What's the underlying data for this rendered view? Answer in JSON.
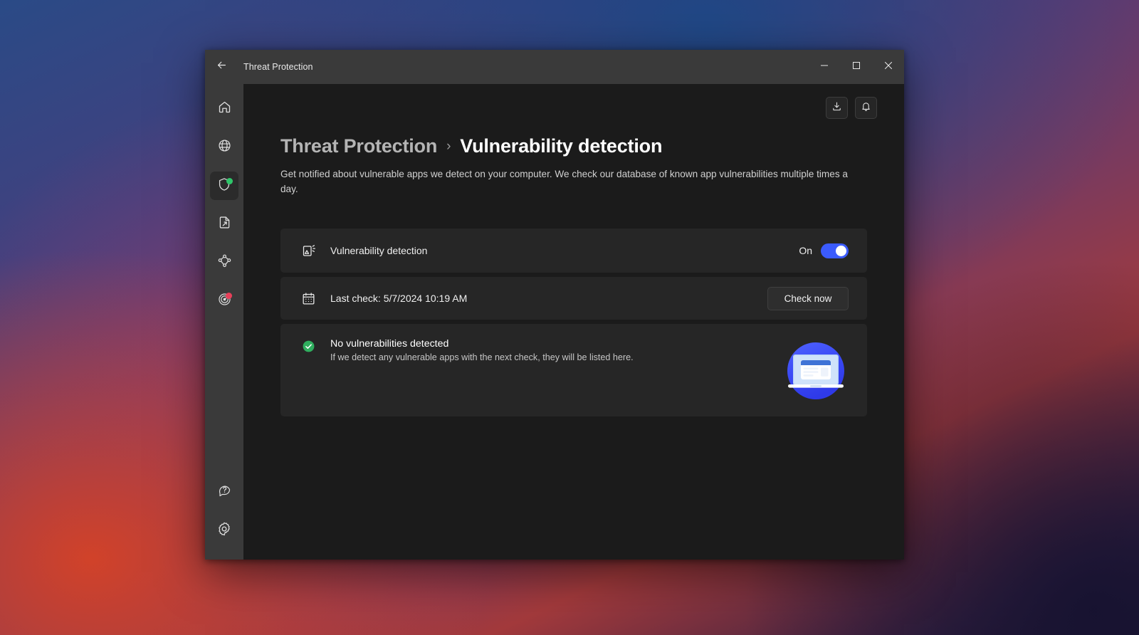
{
  "window": {
    "title": "Threat Protection",
    "back_icon": "arrow-left-icon",
    "controls": {
      "minimize": "minimize-icon",
      "maximize": "maximize-icon",
      "close": "close-icon"
    }
  },
  "sidebar": {
    "items": [
      {
        "name": "home",
        "icon": "home-icon",
        "active": false,
        "badge": null
      },
      {
        "name": "vpn",
        "icon": "globe-icon",
        "active": false,
        "badge": null
      },
      {
        "name": "threat-protection",
        "icon": "shield-icon",
        "active": true,
        "badge": "green"
      },
      {
        "name": "file-share",
        "icon": "file-share-icon",
        "active": false,
        "badge": null
      },
      {
        "name": "meshnet",
        "icon": "meshnet-icon",
        "active": false,
        "badge": null
      },
      {
        "name": "dark-web-monitor",
        "icon": "radar-icon",
        "active": false,
        "badge": "red"
      }
    ],
    "bottom_items": [
      {
        "name": "help",
        "icon": "help-icon"
      },
      {
        "name": "settings",
        "icon": "gear-icon"
      }
    ]
  },
  "content_actions": [
    {
      "name": "downloads",
      "icon": "download-icon"
    },
    {
      "name": "notifications",
      "icon": "bell-icon"
    }
  ],
  "page": {
    "breadcrumb_parent": "Threat Protection",
    "breadcrumb_separator": "›",
    "breadcrumb_current": "Vulnerability detection",
    "description": "Get notified about vulnerable apps we detect on your computer. We check our database of known app vulnerabilities multiple times a day."
  },
  "cards": {
    "toggle_row": {
      "icon": "vulnerability-icon",
      "label": "Vulnerability detection",
      "state_label": "On",
      "enabled": true
    },
    "last_check_row": {
      "icon": "calendar-icon",
      "label": "Last check: 5/7/2024 10:19 AM",
      "button_label": "Check now"
    },
    "result_row": {
      "icon": "check-circle-icon",
      "title": "No vulnerabilities detected",
      "subtitle": "If we detect any vulnerable apps with the next check, they will be listed here.",
      "illustration": "laptop-illustration"
    }
  },
  "colors": {
    "accent": "#3b5bfd",
    "success": "#2fc66a",
    "alert": "#e8405a",
    "window_bg": "#1b1b1b",
    "card_bg": "#262626",
    "chrome_bg": "#3a3a3a"
  }
}
